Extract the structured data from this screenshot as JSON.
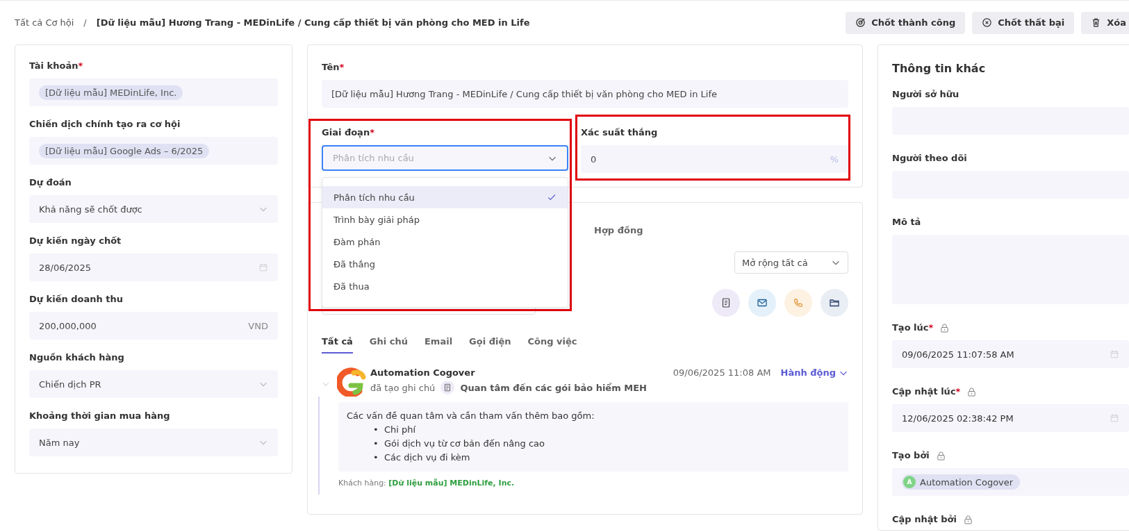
{
  "breadcrumb": {
    "root": "Tất cả Cơ hội",
    "separator": "/",
    "current": "[Dữ liệu mẫu] Hương Trang - MEDinLife / Cung cấp thiết bị văn phòng cho MED in Life"
  },
  "actions": [
    {
      "kind": "won",
      "label": "Chốt thành công"
    },
    {
      "kind": "lost",
      "label": "Chốt thất bại"
    },
    {
      "kind": "delete",
      "label": "Xóa"
    }
  ],
  "left_panel": {
    "fields": [
      {
        "kind": "tag",
        "label": "Tài khoản",
        "required_mark": "*",
        "value": "[Dữ liệu mẫu] MEDinLife, Inc."
      },
      {
        "kind": "tag",
        "label": "Chiến dịch chính tạo ra cơ hội",
        "value": "[Dữ liệu mẫu] Google Ads – 6/2025"
      },
      {
        "kind": "select",
        "label": "Dự đoán",
        "value": "Khả năng sẽ chốt được"
      },
      {
        "kind": "date",
        "label": "Dự kiến ngày chốt",
        "value": "28/06/2025"
      },
      {
        "kind": "currency",
        "label": "Dự kiến doanh thu",
        "value": "200,000,000",
        "suffix": "VND"
      },
      {
        "kind": "select",
        "label": "Nguồn khách hàng",
        "value": "Chiến dịch PR"
      },
      {
        "kind": "select",
        "label": "Khoảng thời gian mua hàng",
        "value": "Năm nay"
      }
    ]
  },
  "main": {
    "name_field": {
      "label": "Tên",
      "required_mark": "*",
      "value": "[Dữ liệu mẫu] Hương Trang - MEDinLife / Cung cấp thiết bị văn phòng cho MED in Life"
    },
    "stage_field": {
      "label": "Giai đoạn",
      "required_mark": "*",
      "highlighted": true,
      "expanded": true,
      "placeholder": "Phân tích nhu cầu",
      "options": [
        {
          "label": "Phân tích nhu cầu",
          "selected": true
        },
        {
          "label": "Trình bày giải pháp",
          "selected": false
        },
        {
          "label": "Đàm phán",
          "selected": false
        },
        {
          "label": "Đã thắng",
          "selected": false
        },
        {
          "label": "Đã thua",
          "selected": false
        }
      ]
    },
    "probability_field": {
      "label": "Xác suất thắng",
      "highlighted": true,
      "value": "0",
      "suffix": "%"
    }
  },
  "activity_panel": {
    "section_tabs": [
      {
        "label": "Hợp đồng",
        "selected": false
      }
    ],
    "expand_select": {
      "value": "Mở rộng tất cả"
    },
    "filter_tabs": [
      {
        "label": "Tất cả",
        "selected": true
      },
      {
        "label": "Ghi chú",
        "selected": false
      },
      {
        "label": "Email",
        "selected": false
      },
      {
        "label": "Gọi điện",
        "selected": false
      },
      {
        "label": "Công việc",
        "selected": false
      }
    ],
    "entries": [
      {
        "author": "Automation Cogover",
        "time": "09/06/2025 11:08 AM",
        "action": "Hành động",
        "verb": "đã tạo ghi chú",
        "subject": "Quan tâm đến các gói bảo hiểm MEH",
        "intro": "Các vấn đề quan tâm và cần tham vấn thêm bao gồm:",
        "bullets": [
          {
            "marker": "•",
            "text": "Chi phí"
          },
          {
            "marker": "•",
            "text": "Gói dịch vụ từ cơ bản đến nâng cao"
          },
          {
            "marker": "•",
            "text": "Các dịch vụ đi kèm"
          }
        ],
        "customer_label": "Khách hàng:",
        "customer_value": "[Dữ liệu mẫu] MEDinLife, Inc."
      }
    ]
  },
  "right_panel": {
    "title": "Thông tin khác",
    "fields": [
      {
        "kind": "empty",
        "label": "Người sở hữu"
      },
      {
        "kind": "empty",
        "label": "Người theo dõi"
      },
      {
        "kind": "textarea",
        "label": "Mô tả"
      },
      {
        "kind": "datetime",
        "label": "Tạo lúc",
        "required_mark": "*",
        "locked": true,
        "value": "09/06/2025 11:07:58 AM"
      },
      {
        "kind": "datetime",
        "label": "Cập nhật lúc",
        "required_mark": "*",
        "locked": true,
        "value": "12/06/2025 02:38:42 PM"
      },
      {
        "kind": "user",
        "label": "Tạo bởi",
        "locked": true,
        "value": "Automation Cogover",
        "initial": "A"
      },
      {
        "kind": "none",
        "label": "Cập nhật bởi",
        "locked": true
      }
    ]
  }
}
